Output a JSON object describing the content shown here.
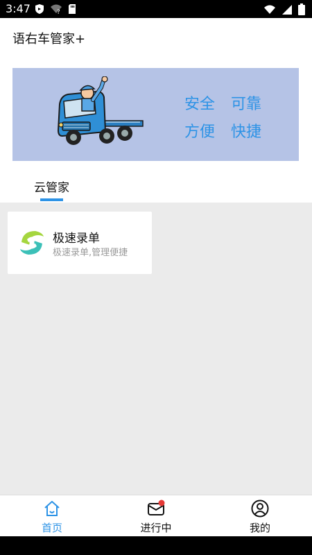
{
  "status": {
    "time": "3:47",
    "icons_left": [
      "shield-icon",
      "wifi-question-icon",
      "sd-card-icon"
    ],
    "icons_right": [
      "wifi-icon",
      "signal-icon",
      "battery-icon"
    ]
  },
  "app": {
    "title": "语右车管家+"
  },
  "banner": {
    "slogans": [
      "安全",
      "可靠",
      "方便",
      "快捷"
    ],
    "image": "truck-driver-waving"
  },
  "tabs": [
    {
      "label": "云管家",
      "selected": true
    }
  ],
  "cards": [
    {
      "title": "极速录单",
      "subtitle": "极速录单,管理便捷",
      "icon": "hands-logo-icon"
    }
  ],
  "bottom_nav": [
    {
      "label": "首页",
      "icon": "home-icon",
      "active": true
    },
    {
      "label": "进行中",
      "icon": "mail-badge-icon",
      "active": false,
      "badge": true
    },
    {
      "label": "我的",
      "icon": "user-icon",
      "active": false
    }
  ],
  "colors": {
    "accent": "#2d93e6",
    "banner_bg": "#b5c3e6",
    "inactive": "#111111",
    "badge": "#e53935"
  }
}
